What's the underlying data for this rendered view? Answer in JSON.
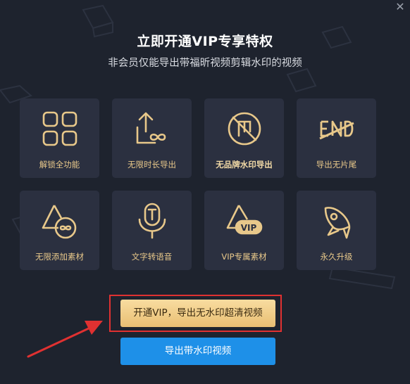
{
  "dialog": {
    "title": "立即开通VIP专享特权",
    "subtitle": "非会员仅能导出带福昕视频剪辑水印的视频",
    "close_glyph": "✕"
  },
  "features": [
    {
      "label": "解锁全功能",
      "icon": "grid-icon"
    },
    {
      "label": "无限时长导出",
      "icon": "export-infinity-icon"
    },
    {
      "label": "无品牌水印导出",
      "icon": "no-watermark-icon"
    },
    {
      "label": "导出无片尾",
      "icon": "no-end-icon"
    },
    {
      "label": "无限添加素材",
      "icon": "material-infinity-icon"
    },
    {
      "label": "文字转语音",
      "icon": "microphone-icon"
    },
    {
      "label": "VIP专属素材",
      "icon": "vip-material-icon"
    },
    {
      "label": "永久升级",
      "icon": "rocket-icon"
    }
  ],
  "buttons": {
    "vip_label": "开通VIP，导出无水印超清视频",
    "export_label": "导出带水印视频"
  },
  "colors": {
    "background": "#1e232e",
    "card": "#2b3040",
    "gold": "#e8c88a",
    "vip_button": "#f0cc88",
    "export_button": "#1e90e8",
    "annotation": "#e03131"
  }
}
